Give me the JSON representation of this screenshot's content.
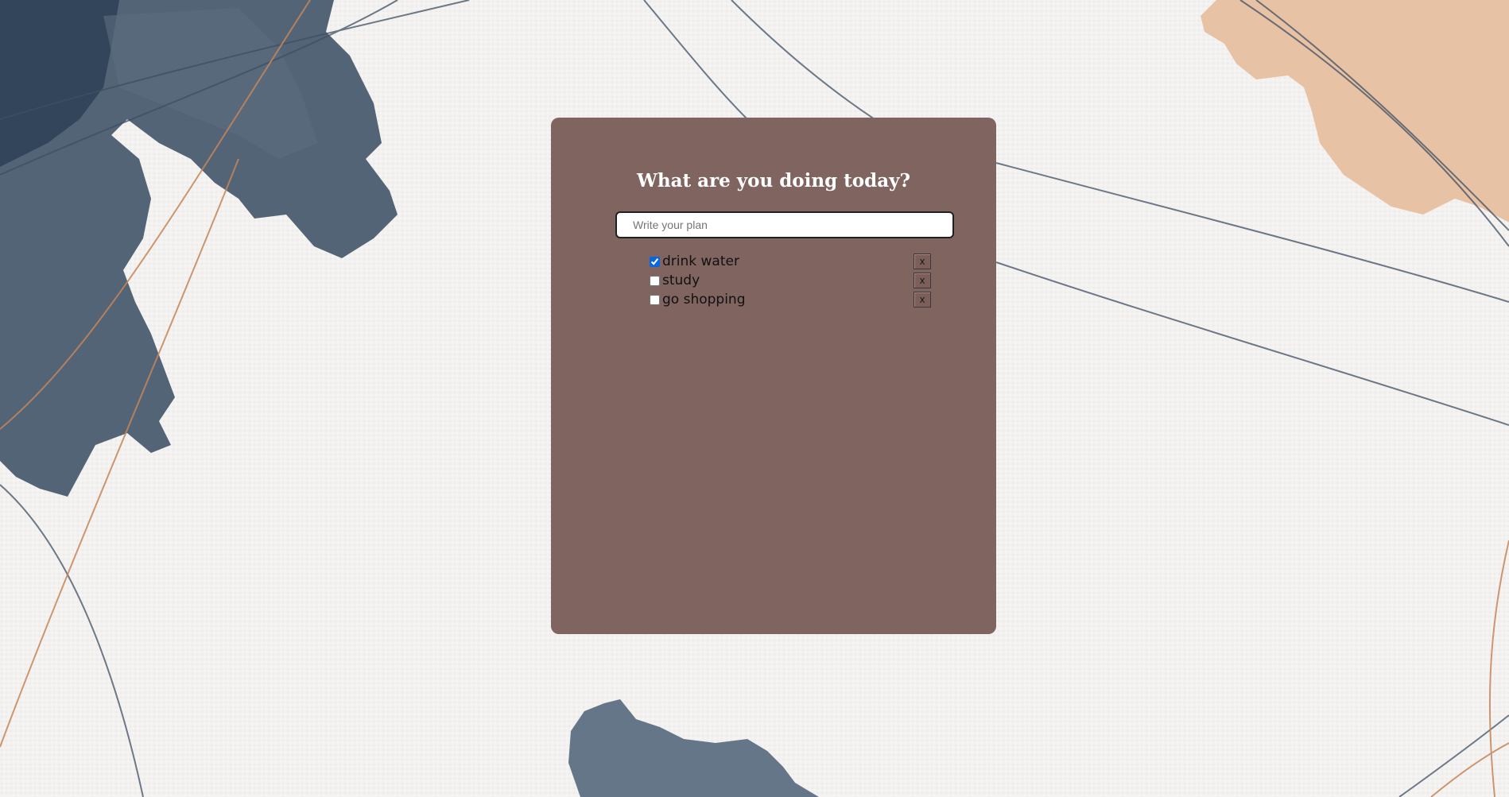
{
  "app": {
    "title": "What are you doing today?"
  },
  "input": {
    "placeholder": "Write your plan",
    "value": ""
  },
  "todos": [
    {
      "text": "drink water",
      "done": true,
      "remove_label": "x"
    },
    {
      "text": "study",
      "done": false,
      "remove_label": "x"
    },
    {
      "text": "go shopping",
      "done": false,
      "remove_label": "x"
    }
  ],
  "colors": {
    "card": "#806460",
    "title": "#ffffff",
    "page_background": "#f3f2f0",
    "watercolor_blue": "#4c5d72",
    "watercolor_peach": "#e6b995",
    "line_copper": "#c58659"
  }
}
